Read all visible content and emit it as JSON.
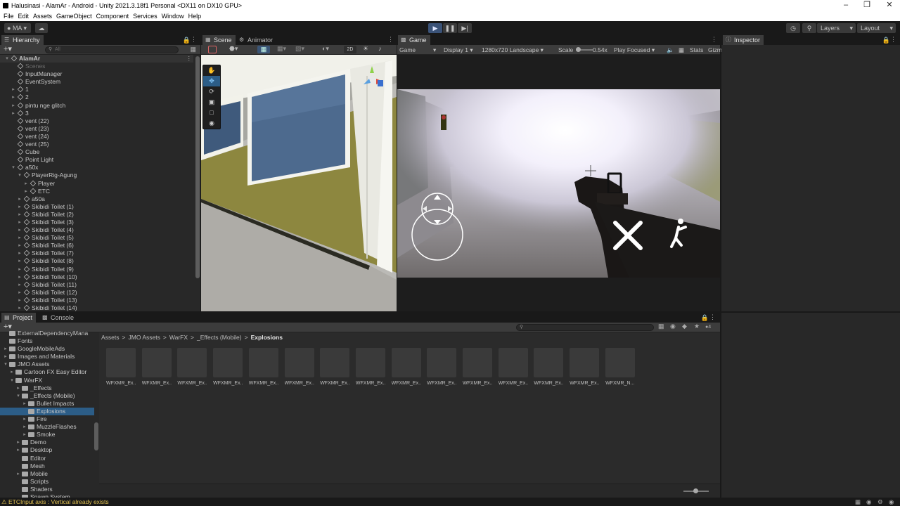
{
  "window": {
    "title": "Halusinasi - AlamAr - Android - Unity 2021.3.18f1 Personal <DX11 on DX10 GPU>"
  },
  "menu": [
    "File",
    "Edit",
    "Assets",
    "GameObject",
    "Component",
    "Services",
    "Window",
    "Help"
  ],
  "toolbar": {
    "account": "MA",
    "layers": "Layers",
    "layout": "Layout"
  },
  "hierarchy": {
    "tab": "Hierarchy",
    "search_placeholder": "All",
    "items": [
      {
        "label": "AlamAr",
        "depth": 0,
        "arrow": "down",
        "scene": true
      },
      {
        "label": "Scenes",
        "depth": 1,
        "dim": true
      },
      {
        "label": "InputManager",
        "depth": 1
      },
      {
        "label": "EventSystem",
        "depth": 1
      },
      {
        "label": "1",
        "depth": 1,
        "arrow": "right"
      },
      {
        "label": "2",
        "depth": 1,
        "arrow": "right"
      },
      {
        "label": "pintu nge glitch",
        "depth": 1,
        "arrow": "right"
      },
      {
        "label": "3",
        "depth": 1,
        "arrow": "right"
      },
      {
        "label": "vent (22)",
        "depth": 1
      },
      {
        "label": "vent (23)",
        "depth": 1
      },
      {
        "label": "vent (24)",
        "depth": 1
      },
      {
        "label": "vent (25)",
        "depth": 1
      },
      {
        "label": "Cube",
        "depth": 1
      },
      {
        "label": "Point Light",
        "depth": 1
      },
      {
        "label": "a50x",
        "depth": 1,
        "arrow": "down"
      },
      {
        "label": "PlayerRig-Agung",
        "depth": 2,
        "arrow": "down"
      },
      {
        "label": "Player",
        "depth": 3,
        "arrow": "right"
      },
      {
        "label": "ETC",
        "depth": 3,
        "arrow": "right"
      },
      {
        "label": "a50a",
        "depth": 2,
        "arrow": "right"
      },
      {
        "label": "Skibidi Toilet (1)",
        "depth": 2,
        "arrow": "right"
      },
      {
        "label": "Skibidi Toilet (2)",
        "depth": 2,
        "arrow": "right"
      },
      {
        "label": "Skibidi Toilet (3)",
        "depth": 2,
        "arrow": "right"
      },
      {
        "label": "Skibidi Toilet (4)",
        "depth": 2,
        "arrow": "right"
      },
      {
        "label": "Skibidi Toilet (5)",
        "depth": 2,
        "arrow": "right"
      },
      {
        "label": "Skibidi Toilet (6)",
        "depth": 2,
        "arrow": "right"
      },
      {
        "label": "Skibidi Toilet (7)",
        "depth": 2,
        "arrow": "right"
      },
      {
        "label": "Skibidi Toilet (8)",
        "depth": 2,
        "arrow": "right"
      },
      {
        "label": "Skibidi Toilet (9)",
        "depth": 2,
        "arrow": "right"
      },
      {
        "label": "Skibidi Toilet (10)",
        "depth": 2,
        "arrow": "right"
      },
      {
        "label": "Skibidi Toilet (11)",
        "depth": 2,
        "arrow": "right"
      },
      {
        "label": "Skibidi Toilet (12)",
        "depth": 2,
        "arrow": "right"
      },
      {
        "label": "Skibidi Toilet (13)",
        "depth": 2,
        "arrow": "right"
      },
      {
        "label": "Skibidi Toilet (14)",
        "depth": 2,
        "arrow": "right"
      }
    ]
  },
  "scene": {
    "tab_scene": "Scene",
    "tab_animator": "Animator",
    "btn_2d": "2D"
  },
  "game": {
    "tab": "Game",
    "display_mode": "Game",
    "display": "Display 1",
    "resolution": "1280x720 Landscape",
    "scale_label": "Scale",
    "scale_value": "0.54x",
    "play_focused": "Play Focused",
    "stats": "Stats",
    "gizmos": "Gizm"
  },
  "inspector": {
    "tab": "Inspector"
  },
  "project": {
    "tab_project": "Project",
    "tab_console": "Console",
    "count": "4",
    "breadcrumb": [
      "Assets",
      "JMO Assets",
      "WarFX",
      "_Effects (Mobile)",
      "Explosions"
    ],
    "folders": [
      {
        "label": "ExternalDependencyMana",
        "depth": 1
      },
      {
        "label": "Fonts",
        "depth": 1
      },
      {
        "label": "GoogleMobileAds",
        "depth": 1,
        "arrow": "right"
      },
      {
        "label": "Images and Materials",
        "depth": 1,
        "arrow": "right"
      },
      {
        "label": "JMO Assets",
        "depth": 1,
        "arrow": "down"
      },
      {
        "label": "Cartoon FX Easy Editor",
        "depth": 2,
        "arrow": "right"
      },
      {
        "label": "WarFX",
        "depth": 2,
        "arrow": "down"
      },
      {
        "label": "_Effects",
        "depth": 3,
        "arrow": "right"
      },
      {
        "label": "_Effects (Mobile)",
        "depth": 3,
        "arrow": "down"
      },
      {
        "label": "Bullet Impacts",
        "depth": 4,
        "arrow": "right"
      },
      {
        "label": "Explosions",
        "depth": 4,
        "selected": true
      },
      {
        "label": "Fire",
        "depth": 4,
        "arrow": "right"
      },
      {
        "label": "MuzzleFlashes",
        "depth": 4,
        "arrow": "right"
      },
      {
        "label": "Smoke",
        "depth": 4,
        "arrow": "right"
      },
      {
        "label": "Demo",
        "depth": 3,
        "arrow": "right"
      },
      {
        "label": "Desktop",
        "depth": 3,
        "arrow": "right"
      },
      {
        "label": "Editor",
        "depth": 3
      },
      {
        "label": "Mesh",
        "depth": 3
      },
      {
        "label": "Mobile",
        "depth": 3,
        "arrow": "right"
      },
      {
        "label": "Scripts",
        "depth": 3
      },
      {
        "label": "Shaders",
        "depth": 3
      },
      {
        "label": "Spawn System",
        "depth": 3
      }
    ],
    "assets": [
      "WFXMR_Ex...",
      "WFXMR_Ex...",
      "WFXMR_Ex...",
      "WFXMR_Ex...",
      "WFXMR_Ex...",
      "WFXMR_Ex...",
      "WFXMR_Ex...",
      "WFXMR_Ex...",
      "WFXMR_Ex...",
      "WFXMR_Ex...",
      "WFXMR_Ex...",
      "WFXMR_Ex...",
      "WFXMR_Ex...",
      "WFXMR_Ex...",
      "WFXMR_N..."
    ]
  },
  "status": {
    "message": "ETCInput axis : Vertical already exists"
  },
  "colors": {
    "selection": "#2c5d87",
    "panel": "#282828",
    "accent_play": "#3b5378",
    "status_warn": "#e0c050"
  }
}
